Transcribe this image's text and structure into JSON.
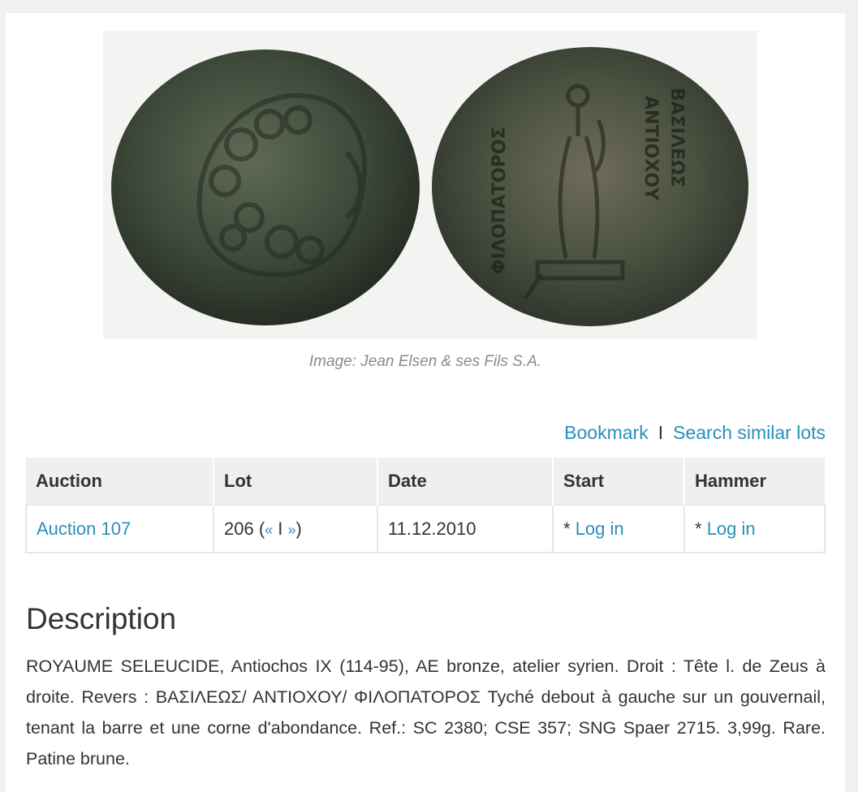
{
  "image": {
    "caption": "Image: Jean Elsen & ses Fils S.A.",
    "coin_left_legend": "",
    "coin_right_legend": "ΒΑΣΙΛΕΩΣ ΑΝΤΙΟΧΟΥ ΦΙΛΟΠΑΤΟΡΟΣ"
  },
  "actions": {
    "bookmark": "Bookmark",
    "separator": "I",
    "search_similar": "Search similar lots"
  },
  "table": {
    "headers": [
      "Auction",
      "Lot",
      "Date",
      "Start",
      "Hammer"
    ],
    "row": {
      "auction": "Auction 107",
      "lot_number": "206 (",
      "lot_prev": "«",
      "lot_sep": " I ",
      "lot_next": "»",
      "lot_close": ")",
      "date": "11.12.2010",
      "start_prefix": "* ",
      "start_link": "Log in",
      "hammer_prefix": "* ",
      "hammer_link": "Log in"
    }
  },
  "description": {
    "title": "Description",
    "text": "ROYAUME SELEUCIDE, Antiochos IX (114-95), AE bronze, atelier syrien. Droit : Tête l. de Zeus à droite. Revers : ΒΑΣΙΛΕΩΣ/ ΑΝΤΙΟΧΟΥ/ ΦΙΛΟΠΑΤΟΡΟΣ Tyché debout à gauche sur un gouvernail, tenant la barre et une corne d'abondance. Ref.: SC 2380; CSE 357; SNG Spaer 2715. 3,99g. Rare. Patine brune."
  },
  "colors": {
    "link": "#2a8fbd",
    "header_bg": "#efefef",
    "page_bg": "#f0f0f0"
  }
}
